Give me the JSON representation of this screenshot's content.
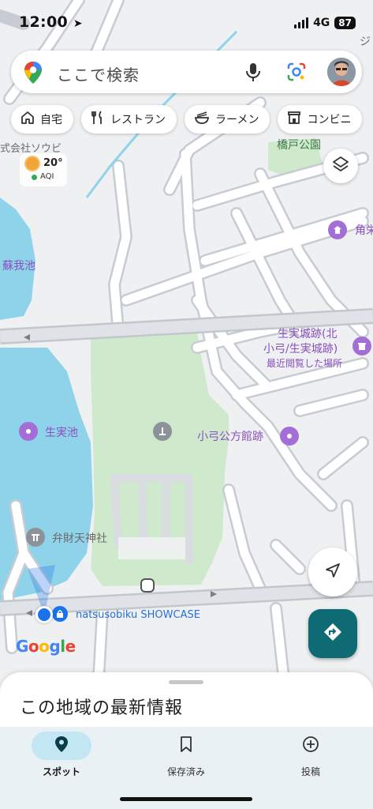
{
  "status_bar": {
    "time": "12:00",
    "network": "4G",
    "battery": "87"
  },
  "search": {
    "placeholder": "ここで検索"
  },
  "chips": [
    {
      "icon": "home-icon",
      "label": "自宅"
    },
    {
      "icon": "restaurant-icon",
      "label": "レストラン"
    },
    {
      "icon": "ramen-icon",
      "label": "ラーメン"
    },
    {
      "icon": "convenience-store-icon",
      "label": "コンビニ"
    }
  ],
  "weather": {
    "temperature": "20°",
    "aqi_label": "AQI"
  },
  "map_labels": {
    "company": "式会社ソウビ",
    "park_hashido": "橋戸公園",
    "kakuei": "角栄",
    "pond_soga": "蘇我池",
    "castle_title": "生実城跡(北",
    "castle_sub": "小弓/生実城跡)",
    "recently_viewed": "最近閲覧した場所",
    "pond_oyumi": "生実池",
    "oyumi_kukan": "小弓公方館跡",
    "benzaiten": "弁財天神社",
    "showcase": "natsusobiku SHOWCASE",
    "top_right": "ジ"
  },
  "sheet": {
    "title": "この地域の最新情報"
  },
  "nav": [
    {
      "icon": "location-pin-icon",
      "label": "スポット",
      "active": true
    },
    {
      "icon": "bookmark-icon",
      "label": "保存済み",
      "active": false
    },
    {
      "icon": "add-circle-icon",
      "label": "投稿",
      "active": false
    }
  ],
  "colors": {
    "water": "#8fd3ea",
    "park": "#cfe9cc",
    "road": "#ffffff",
    "road_casing": "#c7ccd3",
    "land": "#eef0f2",
    "accent_teal": "#0e6b73",
    "poi_purple": "#a36fd6",
    "user_blue": "#1a73e8"
  }
}
